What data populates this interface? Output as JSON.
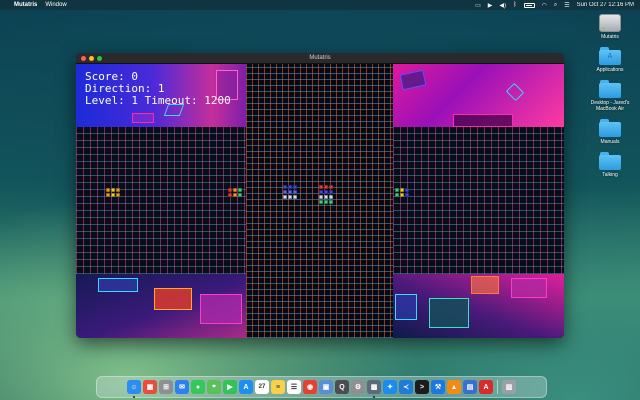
{
  "menubar": {
    "app_name": "Mutatris",
    "menu_items": [
      "Window"
    ],
    "clock": "Sun Oct 27  12:16 PM"
  },
  "window": {
    "title": "Mutatris"
  },
  "hud": {
    "score_line": "Score: 0",
    "direction_line": "Direction: 1",
    "level_line": "Level: 1 Timeout: 1200"
  },
  "desktop": {
    "items": [
      {
        "label": "Mutatris",
        "icon": "drive-icon"
      },
      {
        "label": "Applications",
        "icon": "folder-icon"
      },
      {
        "label": "Desktop - Jared's MacBook Air",
        "icon": "folder-icon"
      },
      {
        "label": "Manuals",
        "icon": "folder-icon"
      },
      {
        "label": "Talking",
        "icon": "folder-icon"
      }
    ]
  },
  "dock": {
    "apps": [
      {
        "name": "finder",
        "color": "#2d8cf0",
        "glyph": "☺"
      },
      {
        "name": "launchpad",
        "color": "#e94b3c",
        "glyph": "▦"
      },
      {
        "name": "launcher",
        "color": "#8e8e93",
        "glyph": "⊞"
      },
      {
        "name": "mail",
        "color": "#2f7ff0",
        "glyph": "✉"
      },
      {
        "name": "messages",
        "color": "#34c759",
        "glyph": "●"
      },
      {
        "name": "maps",
        "color": "#5ac05a",
        "glyph": "⌖"
      },
      {
        "name": "facetime",
        "color": "#33c257",
        "glyph": "▶"
      },
      {
        "name": "app-store",
        "color": "#1e8ef5",
        "glyph": "A"
      },
      {
        "name": "calendar",
        "color": "#ffffff",
        "glyph": "27"
      },
      {
        "name": "notes",
        "color": "#f6d24a",
        "glyph": "≡"
      },
      {
        "name": "reminders",
        "color": "#ffffff",
        "glyph": "☰"
      },
      {
        "name": "chrome",
        "color": "#e44134",
        "glyph": "◉"
      },
      {
        "name": "preview",
        "color": "#5b8dd6",
        "glyph": "▣"
      },
      {
        "name": "quicktime",
        "color": "#4c4c52",
        "glyph": "Q"
      },
      {
        "name": "system-settings",
        "color": "#8e8e93",
        "glyph": "⚙"
      },
      {
        "name": "mutatris",
        "color": "#5b6b7a",
        "glyph": "▩"
      },
      {
        "name": "safari",
        "color": "#1a8cf0",
        "glyph": "✦"
      },
      {
        "name": "vscode",
        "color": "#1e7bd6",
        "glyph": "≺"
      },
      {
        "name": "terminal",
        "color": "#1c1c1e",
        "glyph": ">"
      },
      {
        "name": "xcode",
        "color": "#1b78e0",
        "glyph": "⚒"
      },
      {
        "name": "vlc",
        "color": "#f28a14",
        "glyph": "▲"
      },
      {
        "name": "editor",
        "color": "#3a6fd0",
        "glyph": "▤"
      },
      {
        "name": "acrobat",
        "color": "#d62c2c",
        "glyph": "A"
      },
      {
        "name": "trash",
        "color": "#9aa0a6",
        "glyph": "▥"
      }
    ]
  },
  "colors": {
    "close": "#ff5f57",
    "minimize": "#febc2e",
    "maximize": "#28c840",
    "accent_pink": "#ff2aa8",
    "accent_cyan": "#3ad8ff"
  }
}
